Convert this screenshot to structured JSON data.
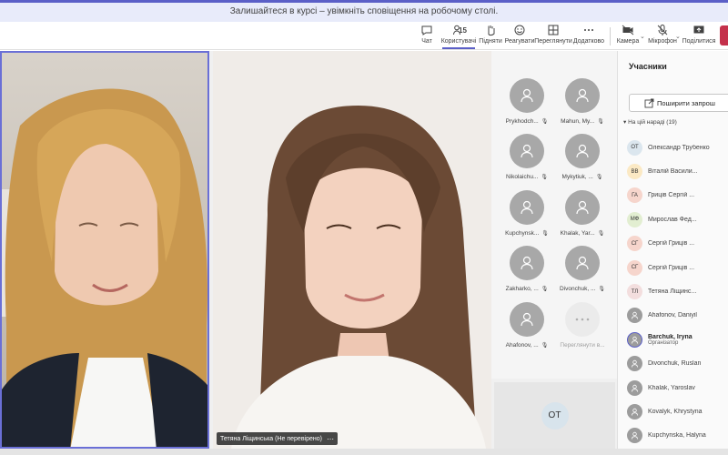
{
  "banner": {
    "text": "Залишайтеся в курсі – увімкніть сповіщення на робочому столі."
  },
  "toolbar": {
    "chat": "Чат",
    "people": "Користувачі",
    "people_count": "15",
    "raise": "Підняти",
    "react": "Реагувати",
    "rooms": "Переглянути",
    "more": "Додатково",
    "camera": "Камера",
    "mic": "Мікрофон",
    "share": "Поділитися"
  },
  "stage": {
    "name_tag": "Тетяна Ліщинська (Не перевірено)"
  },
  "grid": {
    "tiles": [
      {
        "label": "Prykhodch..."
      },
      {
        "label": "Mahun, My..."
      },
      {
        "label": "Nikolaichu..."
      },
      {
        "label": "Mykytiuk, ..."
      },
      {
        "label": "Kupchynsk..."
      },
      {
        "label": "Khalak, Yar..."
      },
      {
        "label": "Zakharko, ..."
      },
      {
        "label": "Divonchuk, ..."
      },
      {
        "label": "Ahafonov, ..."
      },
      {
        "label": "Переглянути в..."
      }
    ],
    "bottom_initials": "ОТ"
  },
  "panel": {
    "title": "Учасники",
    "share_button": "Поширити запрош",
    "section": "На цій нараді (19)",
    "participants": [
      {
        "initials": "ОТ",
        "name": "Олександр Трубенко",
        "color": "#dbe6ee"
      },
      {
        "initials": "ВВ",
        "name": "Віталій Васили...",
        "color": "#fbe9c4"
      },
      {
        "initials": "ГА",
        "name": "Гриців Сергій ...",
        "color": "#f6d5cc"
      },
      {
        "initials": "МФ",
        "name": "Мирослав Фед...",
        "color": "#e2eed1"
      },
      {
        "initials": "СГ",
        "name": "Сергій Гриців ...",
        "color": "#f6d5cc"
      },
      {
        "initials": "СГ",
        "name": "Сергій Гриців ...",
        "color": "#f6d5cc"
      },
      {
        "initials": "ТЛ",
        "name": "Тетяна Ліщинс...",
        "color": "#f3dede"
      },
      {
        "initials": "",
        "name": "Ahafonov, Daniyil",
        "color": "#9c9c9c"
      },
      {
        "initials": "",
        "name": "Barchuk, Iryna",
        "role": "Організатор",
        "color": "#9c9c9c"
      },
      {
        "initials": "",
        "name": "Divonchuk, Ruslan",
        "color": "#9c9c9c"
      },
      {
        "initials": "",
        "name": "Khalak, Yaroslav",
        "color": "#9c9c9c"
      },
      {
        "initials": "",
        "name": "Kovalyk, Khrystyna",
        "color": "#9c9c9c"
      },
      {
        "initials": "",
        "name": "Kupchynska, Halyna",
        "color": "#9c9c9c"
      }
    ]
  },
  "colors": {
    "accent": "#5b5fc7",
    "leave": "#c4314b"
  }
}
